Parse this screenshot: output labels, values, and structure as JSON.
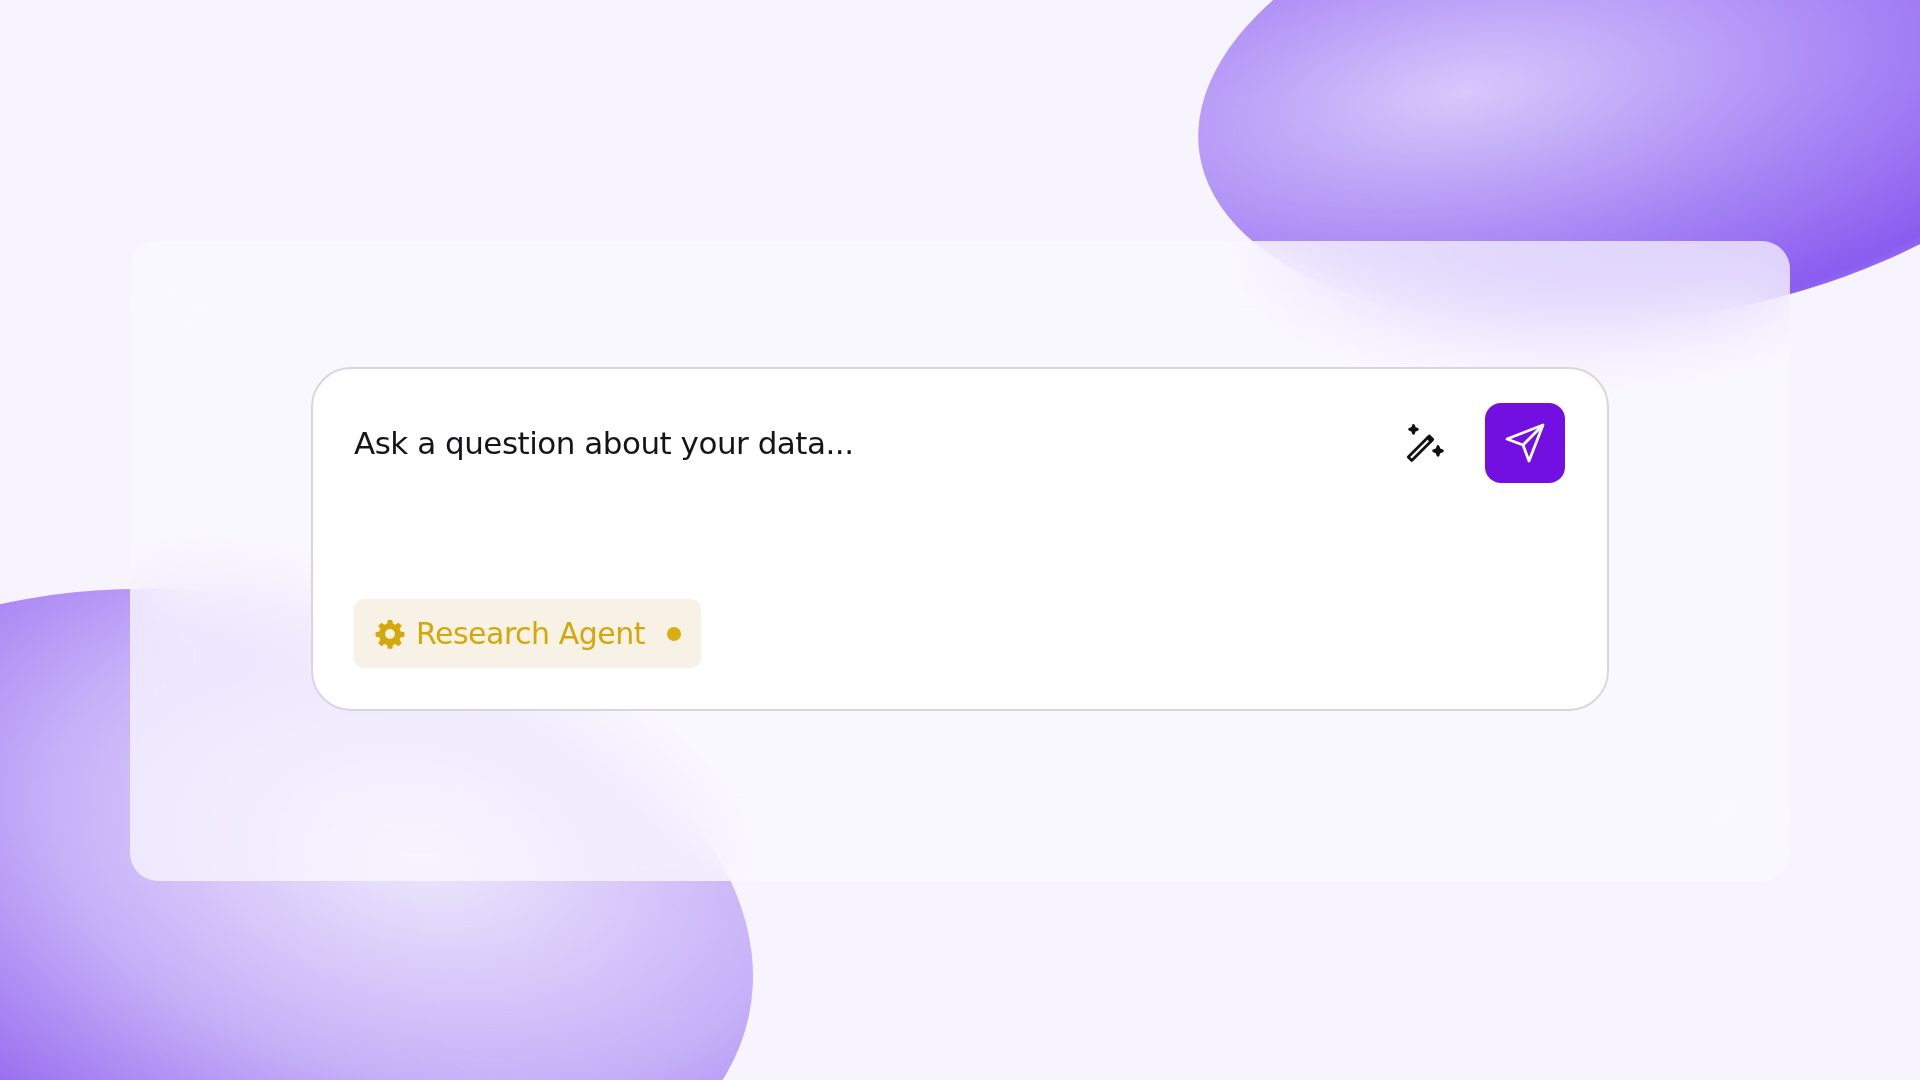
{
  "prompt": {
    "placeholder": "Ask a question about your data..."
  },
  "agent_chip": {
    "label": "Research Agent"
  }
}
